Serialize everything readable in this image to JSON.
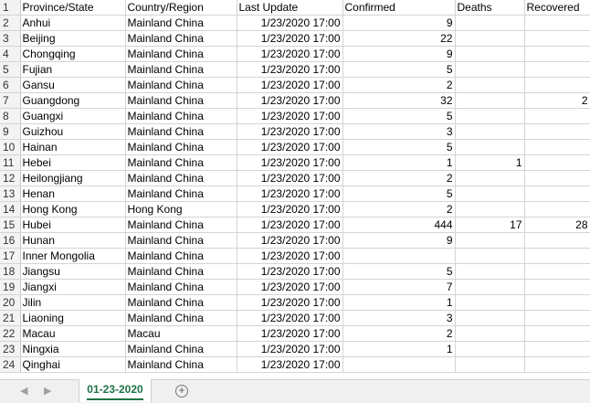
{
  "columns": [
    "Province/State",
    "Country/Region",
    "Last Update",
    "Confirmed",
    "Deaths",
    "Recovered"
  ],
  "rows": [
    {
      "n": "2",
      "province": "Anhui",
      "country": "Mainland China",
      "update": "1/23/2020 17:00",
      "confirmed": "9",
      "deaths": "",
      "recovered": ""
    },
    {
      "n": "3",
      "province": "Beijing",
      "country": "Mainland China",
      "update": "1/23/2020 17:00",
      "confirmed": "22",
      "deaths": "",
      "recovered": ""
    },
    {
      "n": "4",
      "province": "Chongqing",
      "country": "Mainland China",
      "update": "1/23/2020 17:00",
      "confirmed": "9",
      "deaths": "",
      "recovered": ""
    },
    {
      "n": "5",
      "province": "Fujian",
      "country": "Mainland China",
      "update": "1/23/2020 17:00",
      "confirmed": "5",
      "deaths": "",
      "recovered": ""
    },
    {
      "n": "6",
      "province": "Gansu",
      "country": "Mainland China",
      "update": "1/23/2020 17:00",
      "confirmed": "2",
      "deaths": "",
      "recovered": ""
    },
    {
      "n": "7",
      "province": "Guangdong",
      "country": "Mainland China",
      "update": "1/23/2020 17:00",
      "confirmed": "32",
      "deaths": "",
      "recovered": "2"
    },
    {
      "n": "8",
      "province": "Guangxi",
      "country": "Mainland China",
      "update": "1/23/2020 17:00",
      "confirmed": "5",
      "deaths": "",
      "recovered": ""
    },
    {
      "n": "9",
      "province": "Guizhou",
      "country": "Mainland China",
      "update": "1/23/2020 17:00",
      "confirmed": "3",
      "deaths": "",
      "recovered": ""
    },
    {
      "n": "10",
      "province": "Hainan",
      "country": "Mainland China",
      "update": "1/23/2020 17:00",
      "confirmed": "5",
      "deaths": "",
      "recovered": ""
    },
    {
      "n": "11",
      "province": "Hebei",
      "country": "Mainland China",
      "update": "1/23/2020 17:00",
      "confirmed": "1",
      "deaths": "1",
      "recovered": ""
    },
    {
      "n": "12",
      "province": "Heilongjiang",
      "country": "Mainland China",
      "update": "1/23/2020 17:00",
      "confirmed": "2",
      "deaths": "",
      "recovered": ""
    },
    {
      "n": "13",
      "province": "Henan",
      "country": "Mainland China",
      "update": "1/23/2020 17:00",
      "confirmed": "5",
      "deaths": "",
      "recovered": ""
    },
    {
      "n": "14",
      "province": "Hong Kong",
      "country": "Hong Kong",
      "update": "1/23/2020 17:00",
      "confirmed": "2",
      "deaths": "",
      "recovered": ""
    },
    {
      "n": "15",
      "province": "Hubei",
      "country": "Mainland China",
      "update": "1/23/2020 17:00",
      "confirmed": "444",
      "deaths": "17",
      "recovered": "28"
    },
    {
      "n": "16",
      "province": "Hunan",
      "country": "Mainland China",
      "update": "1/23/2020 17:00",
      "confirmed": "9",
      "deaths": "",
      "recovered": ""
    },
    {
      "n": "17",
      "province": "Inner Mongolia",
      "country": "Mainland China",
      "update": "1/23/2020 17:00",
      "confirmed": "",
      "deaths": "",
      "recovered": ""
    },
    {
      "n": "18",
      "province": "Jiangsu",
      "country": "Mainland China",
      "update": "1/23/2020 17:00",
      "confirmed": "5",
      "deaths": "",
      "recovered": ""
    },
    {
      "n": "19",
      "province": "Jiangxi",
      "country": "Mainland China",
      "update": "1/23/2020 17:00",
      "confirmed": "7",
      "deaths": "",
      "recovered": ""
    },
    {
      "n": "20",
      "province": "Jilin",
      "country": "Mainland China",
      "update": "1/23/2020 17:00",
      "confirmed": "1",
      "deaths": "",
      "recovered": ""
    },
    {
      "n": "21",
      "province": "Liaoning",
      "country": "Mainland China",
      "update": "1/23/2020 17:00",
      "confirmed": "3",
      "deaths": "",
      "recovered": ""
    },
    {
      "n": "22",
      "province": "Macau",
      "country": "Macau",
      "update": "1/23/2020 17:00",
      "confirmed": "2",
      "deaths": "",
      "recovered": ""
    },
    {
      "n": "23",
      "province": "Ningxia",
      "country": "Mainland China",
      "update": "1/23/2020 17:00",
      "confirmed": "1",
      "deaths": "",
      "recovered": ""
    },
    {
      "n": "24",
      "province": "Qinghai",
      "country": "Mainland China",
      "update": "1/23/2020 17:00",
      "confirmed": "",
      "deaths": "",
      "recovered": ""
    }
  ],
  "header_row_number": "1",
  "sheet_tab": "01-23-2020",
  "nav_prev_icon": "◀",
  "nav_next_icon": "▶",
  "add_sheet_icon": "+",
  "colors": {
    "accent": "#1e7145",
    "gridline": "#d4d4d4"
  }
}
